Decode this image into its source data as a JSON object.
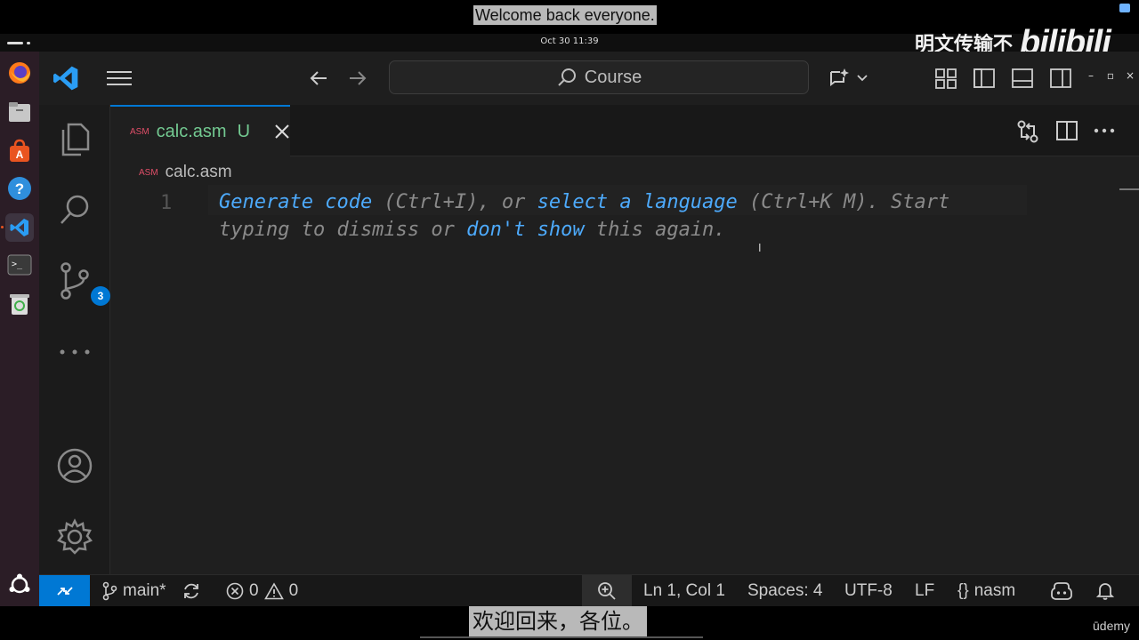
{
  "captions": {
    "top_english": "Welcome back everyone.",
    "bottom_chinese": "欢迎回来，各位。"
  },
  "watermark": {
    "text": "明文传输不",
    "logo": "bilibili"
  },
  "system_bar": {
    "clock": "Oct 30  11:39"
  },
  "dock": {
    "items": [
      "firefox-icon",
      "files-icon",
      "app-center-icon",
      "help-icon",
      "vscode-icon",
      "terminal-icon",
      "trash-icon"
    ],
    "bottom": "ubuntu-apps-icon"
  },
  "titlebar": {
    "command_center_label": "Course"
  },
  "activity_bar": {
    "source_control_badge": "3"
  },
  "tab": {
    "language_tag": "ASM",
    "filename": "calc.asm",
    "status": "U"
  },
  "breadcrumb": {
    "language_tag": "ASM",
    "filename": "calc.asm"
  },
  "editor": {
    "line_number": "1",
    "hint": {
      "link_generate": "Generate code",
      "text_1": " (Ctrl+I), or ",
      "link_select": "select a language",
      "text_2": " (Ctrl+K M). Start typing to dismiss or ",
      "link_dont_show": "don't show",
      "text_3": " this again."
    }
  },
  "statusbar": {
    "branch": "main*",
    "errors": "0",
    "warnings": "0",
    "position": "Ln 1, Col 1",
    "spaces": "Spaces: 4",
    "encoding": "UTF-8",
    "eol": "LF",
    "language": "nasm"
  },
  "branding": {
    "udemy": "ūdemy"
  },
  "colors": {
    "accent": "#0078d4",
    "untracked_file": "#73c991",
    "link": "#4daafc",
    "asm_tag": "#e04e68"
  }
}
